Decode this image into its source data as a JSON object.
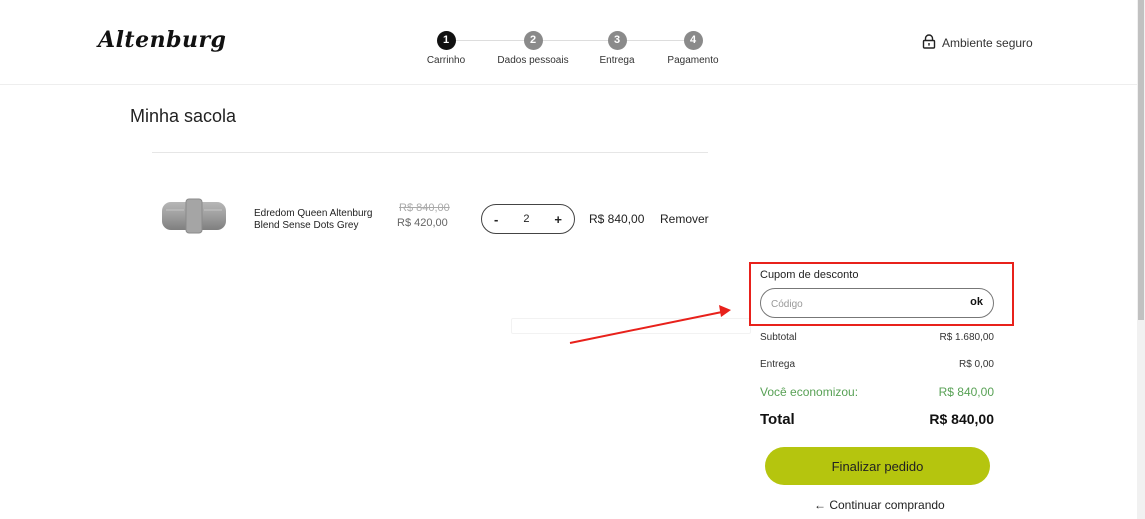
{
  "header": {
    "logo": "Altenburg",
    "secure_label": "Ambiente seguro",
    "steps": [
      {
        "number": "1",
        "label": "Carrinho",
        "active": true
      },
      {
        "number": "2",
        "label": "Dados pessoais",
        "active": false
      },
      {
        "number": "3",
        "label": "Entrega",
        "active": false
      },
      {
        "number": "4",
        "label": "Pagamento",
        "active": false
      }
    ]
  },
  "page_title": "Minha sacola",
  "cart_item": {
    "name": "Edredom Queen Altenburg Blend Sense Dots Grey",
    "old_price": "R$ 840,00",
    "price": "R$ 420,00",
    "qty_minus": "-",
    "quantity": "2",
    "qty_plus": "+",
    "line_total": "R$ 840,00",
    "remove_label": "Remover"
  },
  "coupon": {
    "label": "Cupom de desconto",
    "placeholder": "Código",
    "ok_label": "ok"
  },
  "summary": {
    "subtotal_label": "Subtotal",
    "subtotal_value": "R$ 1.680,00",
    "delivery_label": "Entrega",
    "delivery_value": "R$ 0,00",
    "savings_label": "Você economizou:",
    "savings_value": "R$ 840,00",
    "total_label": "Total",
    "total_value": "R$ 840,00"
  },
  "actions": {
    "checkout_label": "Finalizar pedido",
    "continue_label": "← Continuar comprando"
  },
  "colors": {
    "accent_green": "#b5c50e",
    "savings_green": "#58a155",
    "highlight_red": "#e8211b"
  }
}
